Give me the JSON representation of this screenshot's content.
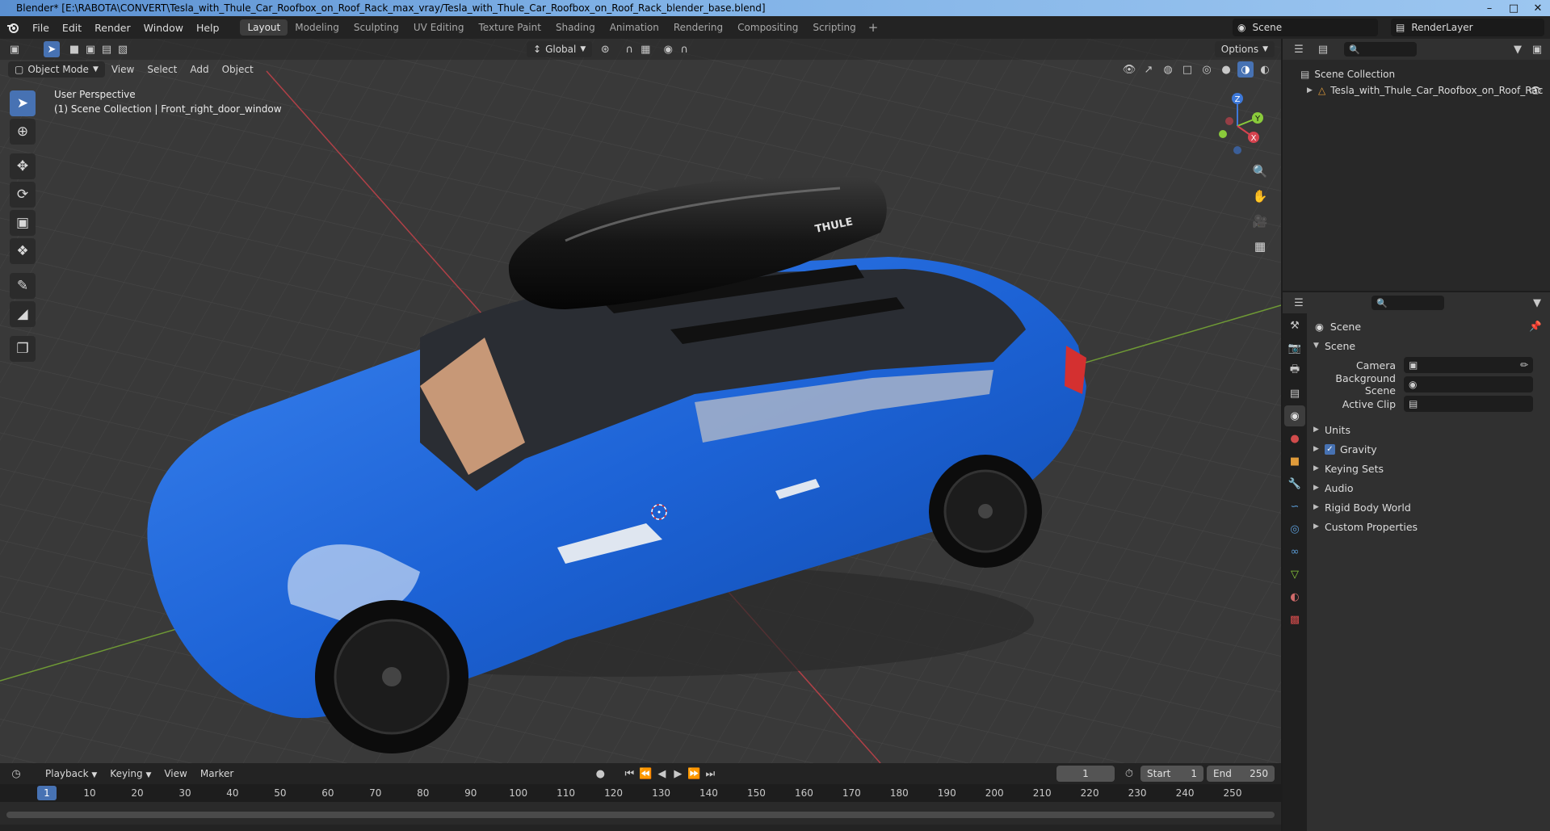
{
  "window": {
    "title": "Blender* [E:\\RABOTA\\CONVERT\\Tesla_with_Thule_Car_Roofbox_on_Roof_Rack_max_vray/Tesla_with_Thule_Car_Roofbox_on_Roof_Rack_blender_base.blend]",
    "controls": [
      "–",
      "□",
      "✕"
    ]
  },
  "menu": {
    "items": [
      "File",
      "Edit",
      "Render",
      "Window",
      "Help"
    ],
    "workspaces": [
      "Layout",
      "Modeling",
      "Sculpting",
      "UV Editing",
      "Texture Paint",
      "Shading",
      "Animation",
      "Rendering",
      "Compositing",
      "Scripting"
    ],
    "active_workspace": "Layout",
    "add_icon": "+",
    "scene": "Scene",
    "view_layer": "RenderLayer"
  },
  "viewport": {
    "transform_orientation": "Global",
    "options_label": "Options",
    "mode": "Object Mode",
    "header_menus": [
      "View",
      "Select",
      "Add",
      "Object"
    ],
    "perspective": "User Perspective",
    "collection_info": "(1) Scene Collection | Front_right_door_window",
    "gizmo_axes": {
      "x": "X",
      "y": "Y",
      "z": "Z"
    },
    "colors": {
      "x_axis": "#d6434f",
      "y_axis": "#8acb3b",
      "z_axis": "#3d78d9",
      "grid": "#464646",
      "background": "#393939",
      "car_body": "#1d63d6"
    },
    "car_brand": "THULE"
  },
  "tools": [
    "select-box",
    "cursor",
    "move",
    "rotate",
    "scale",
    "transform",
    "annotate",
    "measure",
    "add-cube"
  ],
  "timeline": {
    "menus": [
      "Playback",
      "Keying",
      "View",
      "Marker"
    ],
    "current_frame": "1",
    "start_label": "Start",
    "start": "1",
    "end_label": "End",
    "end": "250",
    "ruler": [
      "1",
      "10",
      "20",
      "30",
      "40",
      "50",
      "60",
      "70",
      "80",
      "90",
      "100",
      "110",
      "120",
      "130",
      "140",
      "150",
      "160",
      "170",
      "180",
      "190",
      "200",
      "210",
      "220",
      "230",
      "240",
      "250"
    ]
  },
  "outliner": {
    "root": "Scene Collection",
    "items": [
      {
        "name": "Tesla_with_Thule_Car_Roofbox_on_Roof_Rac"
      }
    ]
  },
  "properties": {
    "context": "Scene",
    "section": "Scene",
    "fields": [
      {
        "label": "Camera",
        "value": ""
      },
      {
        "label": "Background Scene",
        "value": ""
      },
      {
        "label": "Active Clip",
        "value": ""
      }
    ],
    "panels": [
      {
        "label": "Units",
        "checkbox": false
      },
      {
        "label": "Gravity",
        "checkbox": true
      },
      {
        "label": "Keying Sets",
        "checkbox": false
      },
      {
        "label": "Audio",
        "checkbox": false
      },
      {
        "label": "Rigid Body World",
        "checkbox": false
      },
      {
        "label": "Custom Properties",
        "checkbox": false
      }
    ]
  }
}
